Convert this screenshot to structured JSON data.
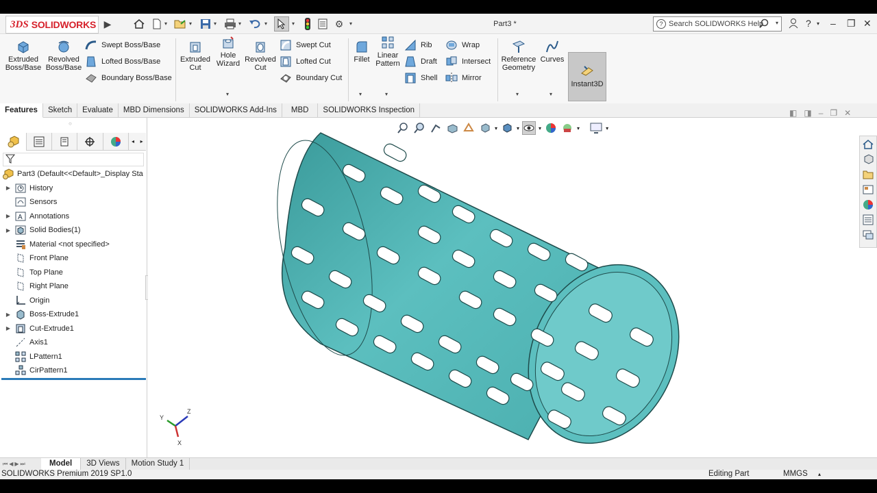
{
  "titlebar": {
    "logo_prefix": "3DS",
    "brand": "SOLIDWORKS",
    "document_title": "Part3 *",
    "search_placeholder": "Search SOLIDWORKS Help"
  },
  "features_toolbar": {
    "extruded_boss": "Extruded Boss/Base",
    "revolved_boss": "Revolved Boss/Base",
    "swept_boss": "Swept Boss/Base",
    "lofted_boss": "Lofted Boss/Base",
    "boundary_boss": "Boundary Boss/Base",
    "extruded_cut": "Extruded Cut",
    "hole_wizard": "Hole Wizard",
    "revolved_cut": "Revolved Cut",
    "swept_cut": "Swept Cut",
    "lofted_cut": "Lofted Cut",
    "boundary_cut": "Boundary Cut",
    "fillet": "Fillet",
    "linear_pattern": "Linear Pattern",
    "rib": "Rib",
    "draft": "Draft",
    "shell": "Shell",
    "wrap": "Wrap",
    "intersect": "Intersect",
    "mirror": "Mirror",
    "reference_geometry": "Reference Geometry",
    "curves": "Curves",
    "instant3d": "Instant3D"
  },
  "command_tabs": [
    "Features",
    "Sketch",
    "Evaluate",
    "MBD Dimensions",
    "SOLIDWORKS Add-Ins",
    "MBD",
    "SOLIDWORKS Inspection"
  ],
  "tree": {
    "root": "Part3  (Default<<Default>_Display Sta",
    "items": [
      {
        "label": "History",
        "icon": "history-icon",
        "expand": true
      },
      {
        "label": "Sensors",
        "icon": "sensor-icon",
        "expand": false
      },
      {
        "label": "Annotations",
        "icon": "annotation-icon",
        "expand": true
      },
      {
        "label": "Solid Bodies(1)",
        "icon": "solid-bodies-icon",
        "expand": true
      },
      {
        "label": "Material <not specified>",
        "icon": "material-icon",
        "expand": false
      },
      {
        "label": "Front Plane",
        "icon": "plane-icon",
        "expand": false
      },
      {
        "label": "Top Plane",
        "icon": "plane-icon",
        "expand": false
      },
      {
        "label": "Right Plane",
        "icon": "plane-icon",
        "expand": false
      },
      {
        "label": "Origin",
        "icon": "origin-icon",
        "expand": false
      },
      {
        "label": "Boss-Extrude1",
        "icon": "extrude-icon",
        "expand": true
      },
      {
        "label": "Cut-Extrude1",
        "icon": "cut-extrude-icon",
        "expand": true
      },
      {
        "label": "Axis1",
        "icon": "axis-icon",
        "expand": false
      },
      {
        "label": "LPattern1",
        "icon": "linear-pattern-icon",
        "expand": false
      },
      {
        "label": "CirPattern1",
        "icon": "circular-pattern-icon",
        "expand": false
      }
    ]
  },
  "bottom_tabs": [
    "Model",
    "3D Views",
    "Motion Study 1"
  ],
  "status": {
    "version": "SOLIDWORKS Premium 2019 SP1.0",
    "mode": "Editing Part",
    "units": "MMGS"
  },
  "triad": {
    "x": "X",
    "y": "Y",
    "z": "Z"
  },
  "colors": {
    "model": "#5cbfbf",
    "model_dark": "#2f8a8a",
    "accent_blue": "#2a7ab8",
    "logo_red": "#d6202a"
  }
}
